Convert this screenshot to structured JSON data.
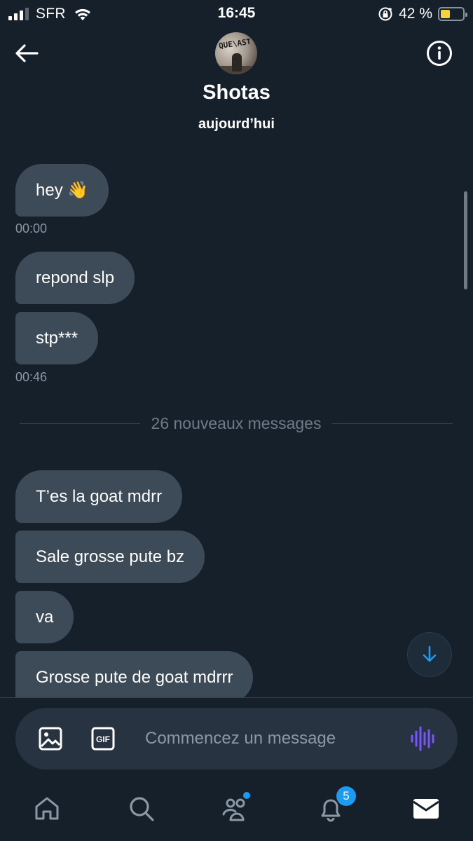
{
  "status_bar": {
    "carrier": "SFR",
    "time": "16:45",
    "battery_percent_label": "42 %",
    "battery_level": 0.42
  },
  "header": {
    "contact_name": "Shotas",
    "day_label": "aujourd’hui",
    "avatar_text": "QUE\\AST"
  },
  "messages": [
    {
      "text": "hey 👋",
      "timestamp": "00:00"
    },
    {
      "text": "repond slp"
    },
    {
      "text": "stp***",
      "timestamp": "00:46"
    },
    {
      "text": "T’es la goat mdrr"
    },
    {
      "text": "Sale grosse pute bz"
    },
    {
      "text": "va"
    },
    {
      "text": "Grosse pute de goat mdrrr"
    }
  ],
  "divider": {
    "label": "26 nouveaux messages"
  },
  "composer": {
    "placeholder": "Commencez un message"
  },
  "tab_bar": {
    "notifications_count": "5"
  },
  "colors": {
    "background": "#15202b",
    "bubble": "#3d4a57",
    "accent": "#1d9bf0",
    "voice": "#7856ff"
  },
  "icons": [
    "back-arrow-icon",
    "info-icon",
    "image-icon",
    "gif-icon",
    "voice-wave-icon",
    "arrow-down-icon",
    "home-icon",
    "search-icon",
    "communities-icon",
    "bell-icon",
    "mail-icon"
  ]
}
